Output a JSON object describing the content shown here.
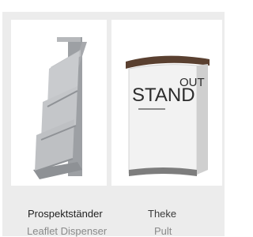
{
  "products": [
    {
      "name_de": "Prospektständer",
      "name_en": "Leaflet Dispenser"
    },
    {
      "name_de": "Theke",
      "name_en": "Pult",
      "image_text": {
        "stand": "STAND",
        "out": "OUT"
      }
    }
  ],
  "colors": {
    "panel_bg": "#ececec",
    "tile_bg": "#ffffff",
    "rack_metal": "#a7a9ad",
    "counter_top": "#5a4030",
    "counter_body": "#f2f2f2"
  }
}
